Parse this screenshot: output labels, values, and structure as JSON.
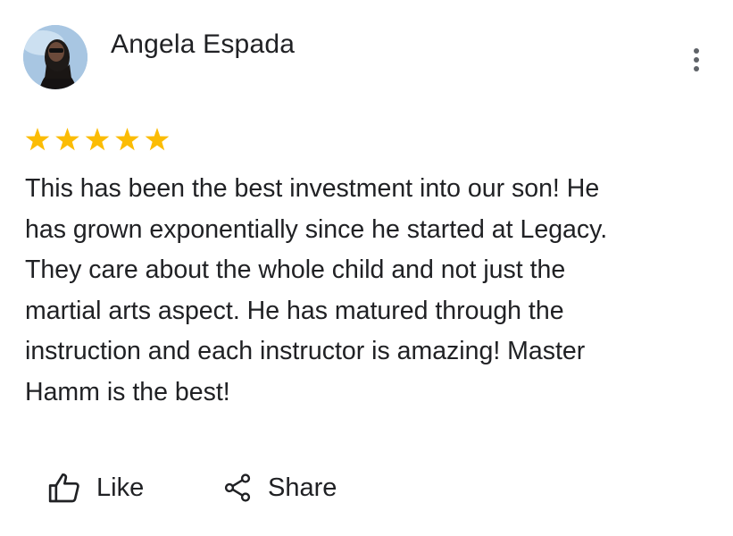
{
  "review": {
    "author_name": "Angela Espada",
    "rating": 5,
    "rating_max": 5,
    "text_lines": [
      "This has been the best investment into our son!  He",
      "has grown exponentially since he started at Legacy.",
      "They care about the whole child and not just the",
      "martial arts aspect.  He has matured through the",
      "instruction and each instructor is amazing!  Master",
      "Hamm is the best!"
    ]
  },
  "actions": {
    "like_label": "Like",
    "share_label": "Share"
  },
  "icons": {
    "more": "more-vert-icon",
    "like": "thumb-up-outline-icon",
    "share": "share-icon",
    "star": "star-icon"
  },
  "colors": {
    "star": "#fbbc04",
    "text": "#202124",
    "icon": "#5f6368"
  }
}
